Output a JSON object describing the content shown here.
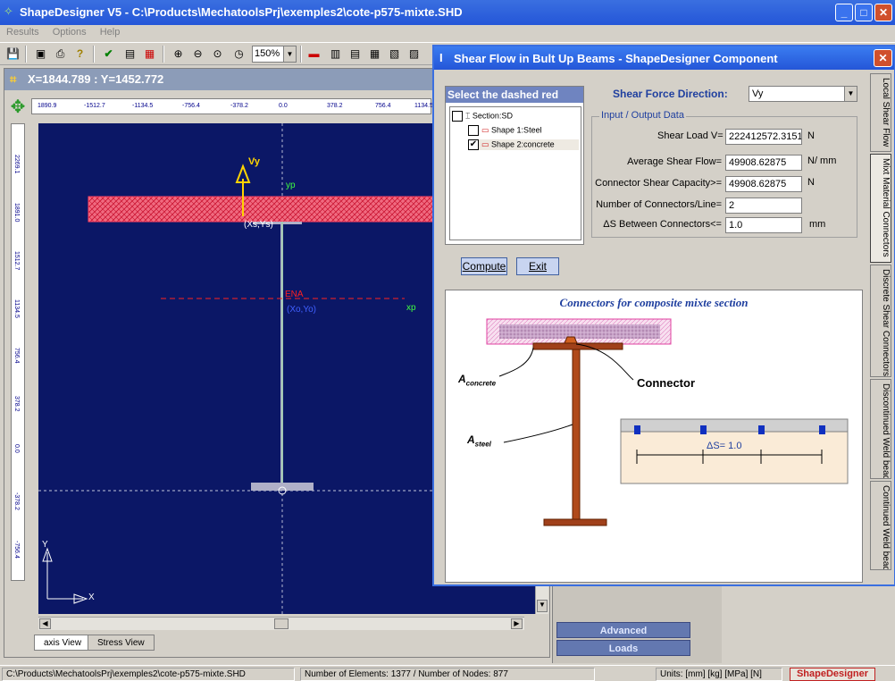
{
  "app": {
    "title": "ShapeDesigner  V5 - C:\\Products\\MechatoolsPrj\\exemples2\\cote-p575-mixte.SHD",
    "window_buttons": {
      "minimize": "_",
      "maximize": "□",
      "close": "✕"
    }
  },
  "menu": [
    "Results",
    "Options",
    "Help"
  ],
  "toolbar": {
    "zoom": "150%"
  },
  "drawing": {
    "coords": "X=1844.789 : Y=1452.772",
    "ruler_ticks": [
      "1890.9",
      "-1512.7",
      "-1134.5",
      "-756.4",
      "-378.2",
      "0.0",
      "378.2",
      "756.4",
      "1134.5"
    ],
    "vruler_ticks": [
      "2269.1",
      "1891.0",
      "1512.7",
      "1134.5",
      "756.4",
      "378.2",
      "0.0",
      "-378.2",
      "-756.4"
    ],
    "labels": {
      "vy": "Vy",
      "yp": "yp",
      "xsys": "(Xs,Ys)",
      "ena": "ENA",
      "xoyo": "(Xo,Yo)",
      "xp": "xp",
      "axis_y": "Y",
      "axis_x": "X"
    },
    "tabs": [
      "axis View",
      "Stress View"
    ]
  },
  "side_panels": [
    "Advanced",
    "Loads"
  ],
  "status": {
    "path": "C:\\Products\\MechatoolsPrj\\exemples2\\cote-p575-mixte.SHD",
    "elements": "Number of Elements: 1377 / Number of Nodes: 877",
    "units": "Units: [mm] [kg] [MPa] [N]",
    "brand": "ShapeDesigner"
  },
  "dialog": {
    "title": "Shear Flow in Bult Up Beams - ShapeDesigner Component",
    "select_header": "Select the dashed red area",
    "tree": [
      {
        "label": "Section:SD",
        "checked": false
      },
      {
        "label": "Shape 1:Steel",
        "checked": false
      },
      {
        "label": "Shape 2:concrete",
        "checked": true
      }
    ],
    "direction_label": "Shear Force Direction:",
    "direction_value": "Vy",
    "group_title": "Input / Output Data",
    "fields": [
      {
        "label": "Shear Load V=",
        "value": "222412572.3151",
        "unit": "N"
      },
      {
        "label": "Average Shear Flow=",
        "value": "49908.62875",
        "unit": "N/ mm"
      },
      {
        "label": "Connector Shear Capacity>=",
        "value": "49908.62875",
        "unit": "N"
      },
      {
        "label": "Number of Connectors/Line=",
        "value": "2",
        "unit": ""
      },
      {
        "label": "ΔS  Between Connectors<=",
        "value": "1.0",
        "unit": "mm"
      }
    ],
    "compute_label": "Compute",
    "exit_label": "Exit",
    "picture": {
      "title": "Connectors for composite mixte section",
      "a_concrete": "A",
      "a_concrete_sub": "concrete",
      "connector": "Connector",
      "a_steel": "A",
      "a_steel_sub": "steel",
      "delta_s": "ΔS= 1.0"
    },
    "side_tabs": [
      "Local Shear Flow",
      "Mixt Material Connectors",
      "Discrete Shear Connectors",
      "Discontinued Weld bead",
      "Continued Weld bead"
    ]
  }
}
